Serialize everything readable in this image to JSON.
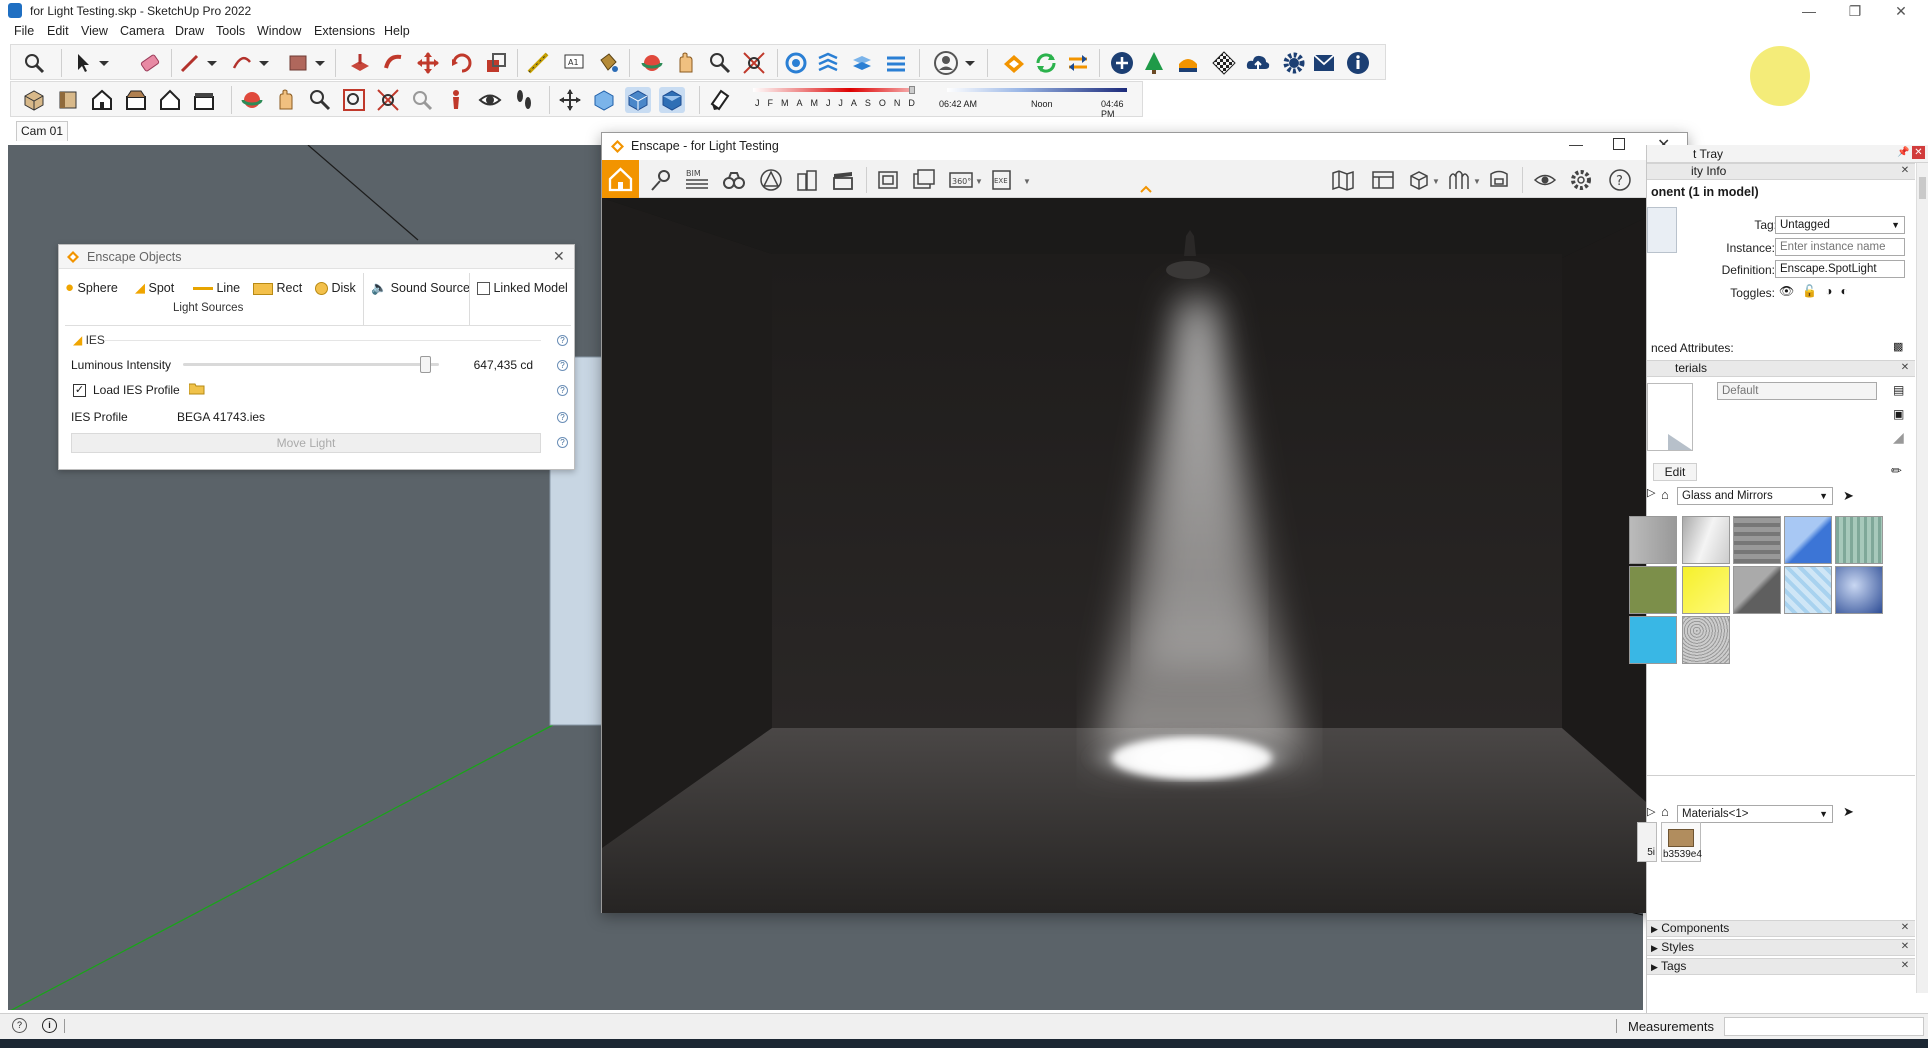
{
  "window": {
    "title": "for Light Testing.skp - SketchUp Pro 2022",
    "minimize_icon": "minimize-icon",
    "maximize_icon": "restore-icon",
    "close_icon": "close-icon"
  },
  "menu": [
    "File",
    "Edit",
    "View",
    "Camera",
    "Draw",
    "Tools",
    "Window",
    "Extensions",
    "Help"
  ],
  "shadow_bar": {
    "months": [
      "J",
      "F",
      "M",
      "A",
      "M",
      "J",
      "J",
      "A",
      "S",
      "O",
      "N",
      "D"
    ],
    "time_start": "06:42 AM",
    "time_mid": "Noon",
    "time_end": "04:46 PM"
  },
  "scene": {
    "tab_label": "Cam 01"
  },
  "enscape_objects": {
    "title": "Enscape Objects",
    "light_types": [
      "Sphere",
      "Spot",
      "Line",
      "Rect",
      "Disk"
    ],
    "sound_source": "Sound Source",
    "linked_model": "Linked Model",
    "group_label": "Light Sources",
    "section_label": "IES",
    "luminous_label": "Luminous Intensity",
    "luminous_value": "647,435 cd",
    "luminous_level": 0.95,
    "load_ies_label": "Load IES Profile",
    "load_ies_checked": true,
    "ies_profile_label": "IES Profile",
    "ies_profile_value": "BEGA 41743.ies",
    "move_light": "Move Light"
  },
  "enscape_window": {
    "title": "Enscape - for Light Testing",
    "toolbar_left_icons": [
      "home-icon",
      "pin-icon",
      "bim-icon",
      "binoculars-icon",
      "tent-icon",
      "buildings-icon",
      "clapperboard-icon",
      "screenshot-icon",
      "batch-render-icon",
      "panorama-360-icon",
      "export-exe-icon"
    ],
    "toolbar_right_icons": [
      "map-icon",
      "asset-library-icon",
      "cube-icon",
      "material-icon",
      "visual-settings-icon",
      "eye-icon",
      "gear-icon",
      "help-icon"
    ],
    "bim_label": "BIM",
    "pano_label": "360°",
    "exe_label": "EXE"
  },
  "tray": {
    "tray_title": "t Tray",
    "entity_info_title": "ity Info",
    "component_title": "onent (1 in model)",
    "tag_label": "Tag:",
    "tag_value": "Untagged",
    "instance_label": "Instance:",
    "instance_placeholder": "Enter instance name",
    "definition_label": "Definition:",
    "definition_value": "Enscape.SpotLight",
    "toggles_label": "Toggles:",
    "advanced_label": "nced Attributes:",
    "materials_title": "terials",
    "material_name": "Default",
    "edit_tab": "Edit",
    "library_select": "Glass and Mirrors",
    "model_select": "Materials<1>",
    "material_partial_label": "5i",
    "material_item_label": "b3539e4",
    "collapsed": [
      "Components",
      "Styles",
      "Tags"
    ]
  },
  "status": {
    "measurements_label": "Measurements"
  },
  "colors": {
    "enscape_accent": "#f29400",
    "sketchup_blue": "#1f6fc2",
    "viewport_bg": "#5a6268"
  }
}
